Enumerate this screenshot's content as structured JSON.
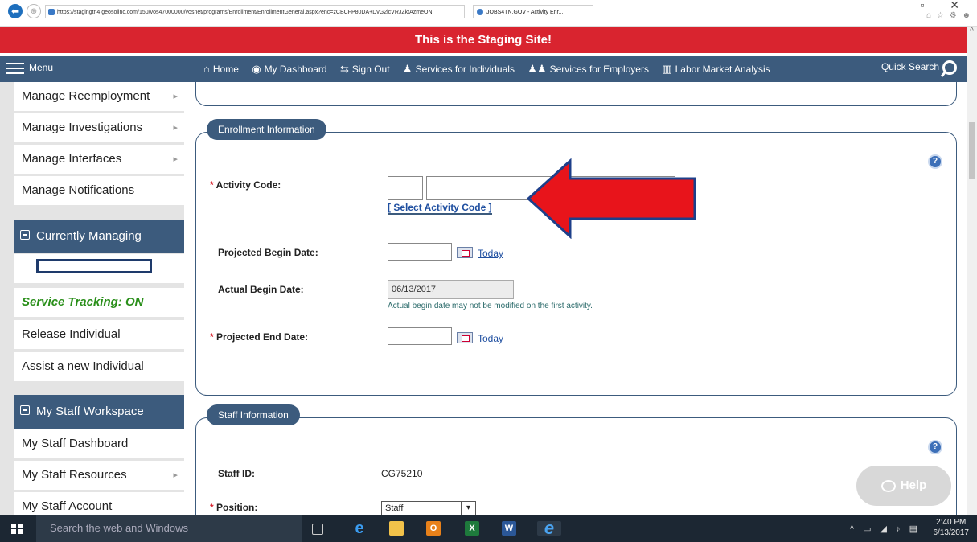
{
  "browser": {
    "url": "https://stagingtn4.geosolinc.com/150/vos47000000/vosnet/programs/Enrollment/EnrollmentGeneral.aspx?enc=zCBCFP80DA+DvG2lcVRJZktAzmeON",
    "tab_title": "JOBS4TN.GOV - Activity Enr...",
    "back_glyph": "⬅",
    "forward_glyph": "⊕",
    "window_controls": "– ▫ ✕",
    "toolbar_icons": "⌂ ☆ ⚙ ☻"
  },
  "banner": {
    "text": "This is the Staging Site!"
  },
  "nav": {
    "menu_label": "Menu",
    "links": [
      {
        "icon": "⌂",
        "label": "Home"
      },
      {
        "icon": "◉",
        "label": "My Dashboard"
      },
      {
        "icon": "⇆",
        "label": "Sign Out"
      },
      {
        "icon": "♟",
        "label": "Services for Individuals"
      },
      {
        "icon": "♟♟",
        "label": "Services for Employers"
      },
      {
        "icon": "▥",
        "label": "Labor Market Analysis"
      }
    ],
    "quick_search_label": "Quick Search"
  },
  "sidebar": {
    "items_top": [
      {
        "label": "Manage Reemployment",
        "has_submenu": true
      },
      {
        "label": "Manage Investigations",
        "has_submenu": true
      },
      {
        "label": "Manage Interfaces",
        "has_submenu": true
      },
      {
        "label": "Manage Notifications",
        "has_submenu": false
      }
    ],
    "currently_managing_header": "Currently Managing",
    "tracking": "Service Tracking: ON",
    "managing_items": [
      "Release Individual",
      "Assist a new Individual"
    ],
    "staff_header": "My Staff Workspace",
    "staff_items": [
      {
        "label": "My Staff Dashboard",
        "has_submenu": false
      },
      {
        "label": "My Staff Resources",
        "has_submenu": true
      },
      {
        "label": "My Staff Account",
        "has_submenu": false
      }
    ]
  },
  "enrollment": {
    "legend": "Enrollment Information",
    "activity_code_label": "Activity Code:",
    "select_activity_link": "[ Select Activity Code ]",
    "projected_begin_label": "Projected Begin Date:",
    "actual_begin_label": "Actual Begin Date:",
    "actual_begin_value": "06/13/2017",
    "actual_begin_hint": "Actual begin date may not be modified on the first activity.",
    "projected_end_label": "Projected End Date:",
    "today_link": "Today",
    "required_marker": "*"
  },
  "staff": {
    "legend": "Staff Information",
    "staff_id_label": "Staff ID:",
    "staff_id_value": "CG75210",
    "position_label": "Position:",
    "position_value": "Staff"
  },
  "help_button": "Help",
  "help_q": "?",
  "taskbar": {
    "search_placeholder": "Search the web and Windows",
    "time": "2:40 PM",
    "date": "6/13/2017",
    "tray": "^ ▭ ◢ ♪ ▤"
  },
  "colors": {
    "banner": "#d9242f",
    "nav": "#3c5b7d",
    "arrow": "#e8141b",
    "tracking": "#2a8f1a"
  }
}
